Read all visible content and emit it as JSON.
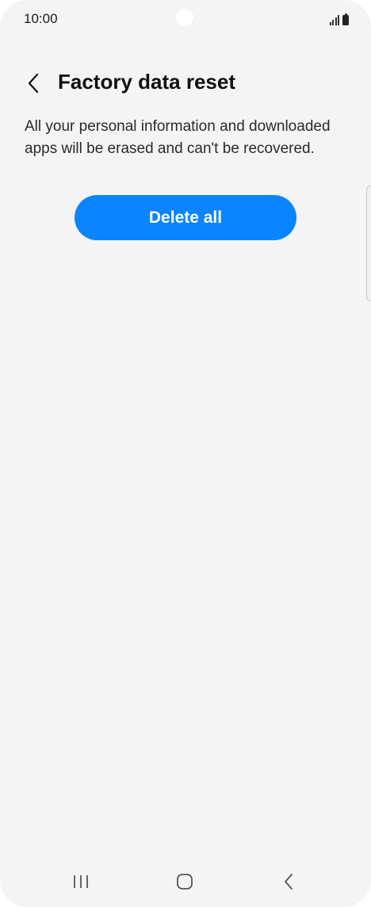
{
  "status_bar": {
    "time": "10:00",
    "icons": [
      "signal-icon",
      "battery-icon"
    ]
  },
  "header": {
    "back_icon": "chevron-left-icon",
    "title": "Factory data reset"
  },
  "content": {
    "description": "All your personal information and downloaded apps will be erased and can't be recovered.",
    "delete_button_label": "Delete all"
  },
  "colors": {
    "background": "#f4f4f4",
    "accent": "#0a84ff",
    "button_text": "#ffffff",
    "text_primary": "#111111"
  },
  "nav_bar": {
    "icons": [
      "recents-icon",
      "home-icon",
      "back-icon"
    ]
  }
}
